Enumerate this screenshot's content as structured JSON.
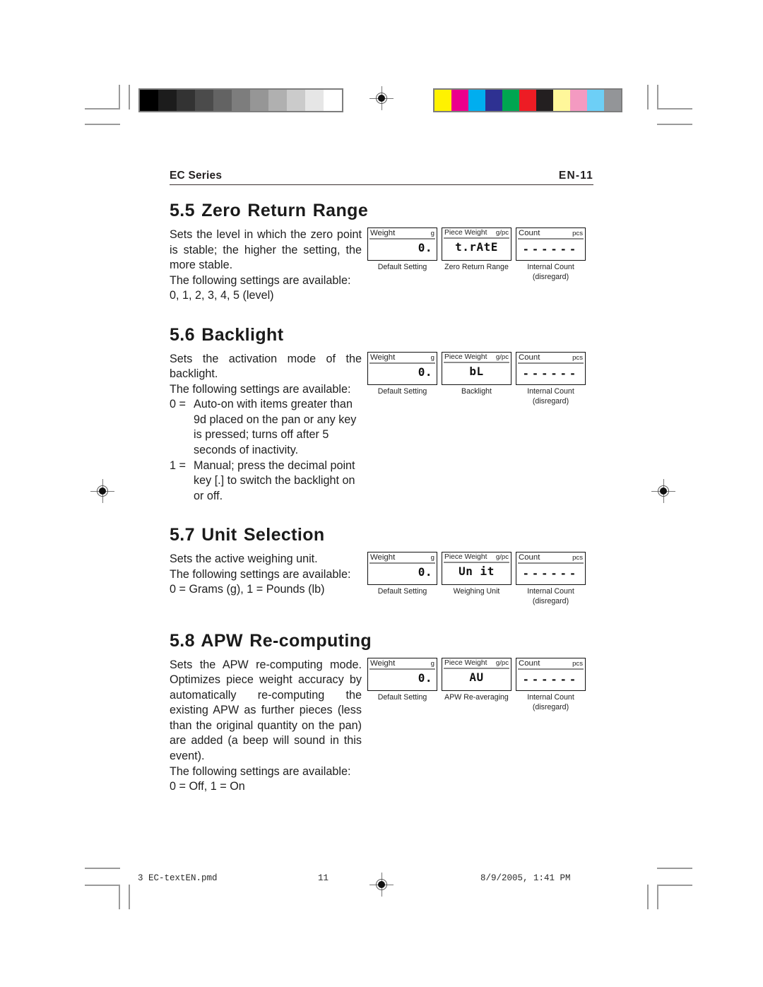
{
  "document": {
    "running_head_left": "EC Series",
    "running_head_right": "EN-11"
  },
  "calibration": {
    "grayscale_label": "grayscale-bar",
    "grayscale_swatches": [
      "#000000",
      "#1c1c1c",
      "#333333",
      "#4b4b4b",
      "#636363",
      "#7d7d7d",
      "#969696",
      "#b0b0b0",
      "#cbcbcb",
      "#e6e6e6",
      "#ffffff"
    ],
    "color_label": "color-bar",
    "color_swatches": [
      "#fff200",
      "#ec008c",
      "#00aeef",
      "#2e3192",
      "#00a651",
      "#ed1c24",
      "#231f20",
      "#fff79a",
      "#f49ac1",
      "#6dcff6",
      "#939598"
    ]
  },
  "sections": [
    {
      "number": "5.5",
      "title": "5.5 Zero Return Range",
      "paragraphs": [
        {
          "type": "just",
          "text": "Sets the level in which the zero point is stable; the higher the setting, the"
        },
        {
          "type": "plain",
          "text": "more stable."
        },
        {
          "type": "plain",
          "text": "The following settings are available:"
        },
        {
          "type": "plain",
          "text": "0, 1, 2, 3, 4, 5 (level)"
        }
      ],
      "displays": [
        {
          "label": "Weight",
          "unit": "g",
          "value": "0.",
          "align": "right",
          "caption": "Default Setting",
          "caption_sub": ""
        },
        {
          "label": "Piece Weight",
          "unit": "g/pc",
          "value": "t.rAtE",
          "align": "center",
          "caption": "Zero Return Range",
          "caption_sub": ""
        },
        {
          "label": "Count",
          "unit": "pcs",
          "value": "------",
          "align": "dashes",
          "caption": "Internal Count",
          "caption_sub": "(disregard)"
        }
      ]
    },
    {
      "number": "5.6",
      "title": "5.6 Backlight",
      "paragraphs": [
        {
          "type": "just",
          "text": "Sets the activation mode of the"
        },
        {
          "type": "plain",
          "text": "backlight."
        },
        {
          "type": "plain",
          "text": "The following settings are available:"
        }
      ],
      "hangs": [
        {
          "marker": "0 =",
          "text": "Auto-on with items greater than 9d placed on the pan or any key is pressed; turns off after 5 seconds of inactivity."
        },
        {
          "marker": "1 =",
          "text": "Manual; press the decimal point key [.] to switch the backlight on or off."
        }
      ],
      "displays": [
        {
          "label": "Weight",
          "unit": "g",
          "value": "0.",
          "align": "right",
          "caption": "Default Setting",
          "caption_sub": ""
        },
        {
          "label": "Piece Weight",
          "unit": "g/pc",
          "value": "bL",
          "align": "center",
          "caption": "Backlight",
          "caption_sub": ""
        },
        {
          "label": "Count",
          "unit": "pcs",
          "value": "------",
          "align": "dashes",
          "caption": "Internal Count",
          "caption_sub": "(disregard)"
        }
      ]
    },
    {
      "number": "5.7",
      "title": "5.7 Unit Selection",
      "paragraphs": [
        {
          "type": "plain",
          "text": "Sets the active weighing unit."
        },
        {
          "type": "plain",
          "text": "The following settings are available:"
        },
        {
          "type": "plain",
          "text": "0 = Grams (g), 1 = Pounds (lb)"
        }
      ],
      "displays": [
        {
          "label": "Weight",
          "unit": "g",
          "value": "0.",
          "align": "right",
          "caption": "Default Setting",
          "caption_sub": ""
        },
        {
          "label": "Piece Weight",
          "unit": "g/pc",
          "value": "Un it",
          "align": "center",
          "caption": "Weighing Unit",
          "caption_sub": ""
        },
        {
          "label": "Count",
          "unit": "pcs",
          "value": "------",
          "align": "dashes",
          "caption": "Internal Count",
          "caption_sub": "(disregard)"
        }
      ]
    },
    {
      "number": "5.8",
      "title": "5.8 APW Re-computing",
      "paragraphs": [
        {
          "type": "just",
          "text": "Sets the APW re-computing mode. Optimizes piece weight accuracy by automatically re-computing the existing APW as further pieces (less than the original quantity on the pan) are added (a beep will sound in this"
        },
        {
          "type": "plain",
          "text": "event)."
        },
        {
          "type": "plain",
          "text": "The following settings are available:"
        },
        {
          "type": "plain",
          "text": "0 = Off, 1 = On"
        }
      ],
      "displays": [
        {
          "label": "Weight",
          "unit": "g",
          "value": "0.",
          "align": "right",
          "caption": "Default Setting",
          "caption_sub": ""
        },
        {
          "label": "Piece Weight",
          "unit": "g/pc",
          "value": "AU",
          "align": "center",
          "caption": "APW Re-averaging",
          "caption_sub": ""
        },
        {
          "label": "Count",
          "unit": "pcs",
          "value": "------",
          "align": "dashes",
          "caption": "Internal Count",
          "caption_sub": "(disregard)"
        }
      ]
    }
  ],
  "footer": {
    "file": "3 EC-textEN.pmd",
    "page": "11",
    "date": "8/9/2005, 1:41 PM"
  }
}
